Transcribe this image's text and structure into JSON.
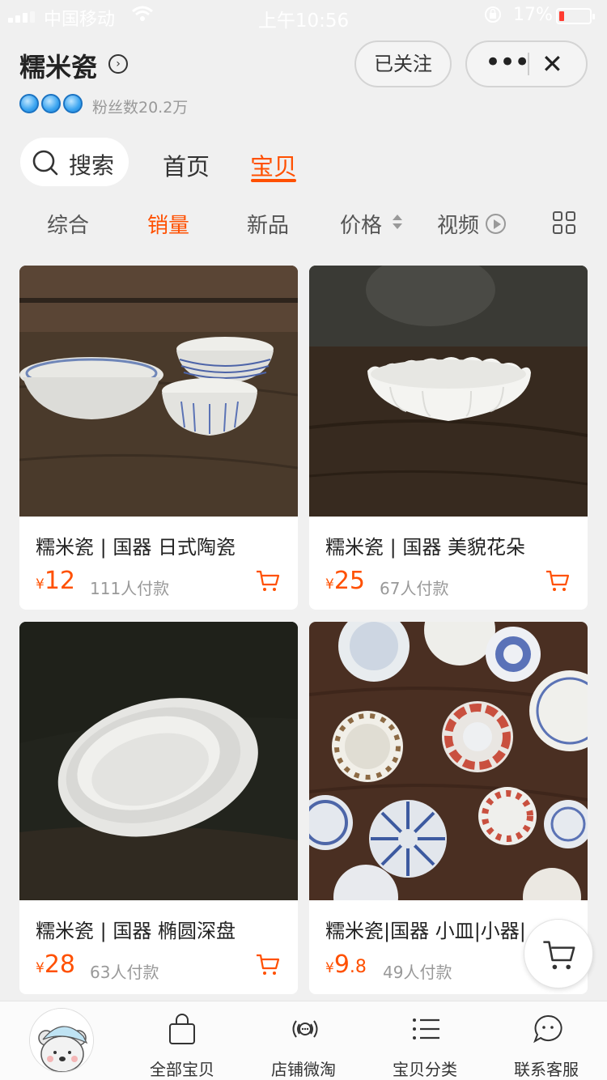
{
  "status_bar": {
    "carrier": "中国移动",
    "time": "上午10:56",
    "battery_text": "17%",
    "battery_level": 0.17,
    "battery_color": "#ff3b30"
  },
  "shop": {
    "name": "糯米瓷",
    "fans": "粉丝数20.2万",
    "follow_label": "已关注"
  },
  "tabs": {
    "search": "搜索",
    "home": "首页",
    "items": "宝贝"
  },
  "sort": {
    "overall": "综合",
    "sales": "销量",
    "new": "新品",
    "price": "价格",
    "video": "视频"
  },
  "products": [
    {
      "title": "糯米瓷 | 国器 日式陶瓷",
      "currency": "¥",
      "price": "12",
      "price_decimal": "",
      "sold": "111人付款"
    },
    {
      "title": "糯米瓷 | 国器 美貌花朵",
      "currency": "¥",
      "price": "25",
      "price_decimal": "",
      "sold": "67人付款"
    },
    {
      "title": "糯米瓷 | 国器 椭圆深盘",
      "currency": "¥",
      "price": "28",
      "price_decimal": "",
      "sold": "63人付款"
    },
    {
      "title": "糯米瓷|国器 小皿|小器|",
      "currency": "¥",
      "price": "9",
      "price_decimal": ".8",
      "sold": "49人付款"
    }
  ],
  "bottom_nav": {
    "all_items": "全部宝贝",
    "weitao": "店铺微淘",
    "categories": "宝贝分类",
    "service": "联系客服"
  },
  "colors": {
    "accent": "#ff5000",
    "background": "#f0f0f0"
  }
}
